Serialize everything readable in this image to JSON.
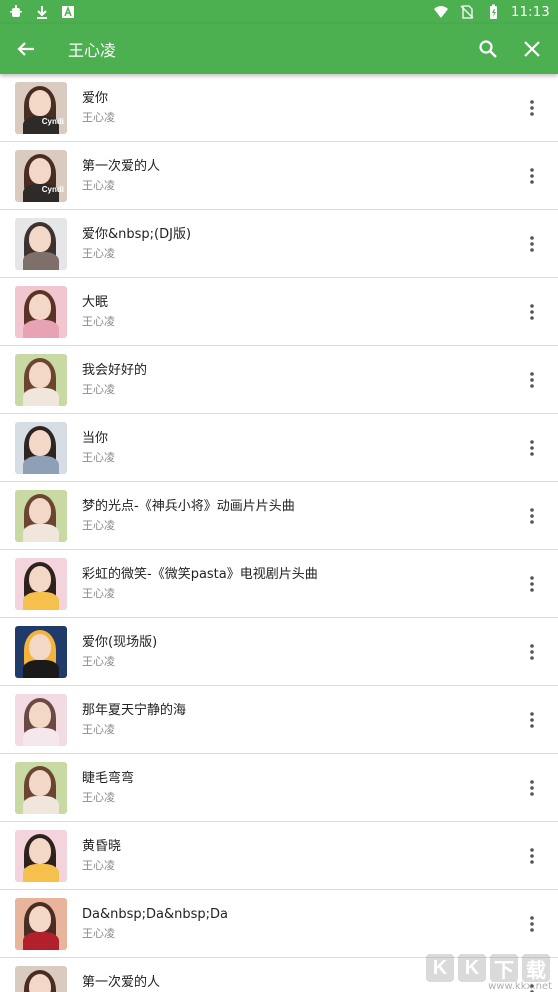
{
  "status_bar": {
    "time": "11:13",
    "left_icons": [
      "bug-icon",
      "download-icon",
      "a-icon"
    ],
    "right_icons": [
      "wifi-icon",
      "no-sim-icon",
      "battery-icon"
    ]
  },
  "app_bar": {
    "title": "王心凌",
    "back_icon": "arrow-back-icon",
    "search_icon": "search-icon",
    "close_icon": "close-icon",
    "color": "#4caf50"
  },
  "songs": [
    {
      "title": "爱你",
      "artist": "王心凌",
      "cover": {
        "bg": "#d9cbbf",
        "hair": "#4a2d22",
        "body": "#2d2a28",
        "tag": "Cyndi"
      }
    },
    {
      "title": "第一次爱的人",
      "artist": "王心凌",
      "cover": {
        "bg": "#d9cbbf",
        "hair": "#4a2d22",
        "body": "#2d2a28",
        "tag": "Cyndi"
      }
    },
    {
      "title": "爱你&nbsp;(DJ版)",
      "artist": "王心凌",
      "cover": {
        "bg": "#e6e6e8",
        "hair": "#3c3330",
        "body": "#7f6f6a",
        "tag": ""
      }
    },
    {
      "title": "大眠",
      "artist": "王心凌",
      "cover": {
        "bg": "#f2c6cf",
        "hair": "#5b3326",
        "body": "#e7a3b4",
        "tag": ""
      }
    },
    {
      "title": "我会好好的",
      "artist": "王心凌",
      "cover": {
        "bg": "#c8d9a3",
        "hair": "#6b4530",
        "body": "#f0e6dc",
        "tag": ""
      }
    },
    {
      "title": "当你",
      "artist": "王心凌",
      "cover": {
        "bg": "#d7dde5",
        "hair": "#2c2522",
        "body": "#8ea0b6",
        "tag": ""
      }
    },
    {
      "title": "梦的光点-《神兵小将》动画片片头曲",
      "artist": "王心凌",
      "cover": {
        "bg": "#c8d9a3",
        "hair": "#6b4530",
        "body": "#f0e6dc",
        "tag": ""
      }
    },
    {
      "title": "彩虹的微笑-《微笑pasta》电视剧片头曲",
      "artist": "王心凌",
      "cover": {
        "bg": "#f3d3dc",
        "hair": "#2f211c",
        "body": "#f6c04c",
        "tag": ""
      }
    },
    {
      "title": "爱你(现场版)",
      "artist": "王心凌",
      "cover": {
        "bg": "#203a6a",
        "hair": "#f4b43a",
        "body": "#1a1a1a",
        "tag": ""
      }
    },
    {
      "title": "那年夏天宁静的海",
      "artist": "王心凌",
      "cover": {
        "bg": "#f2dbe2",
        "hair": "#6b4a44",
        "body": "#f4e8ec",
        "tag": ""
      }
    },
    {
      "title": "睫毛弯弯",
      "artist": "王心凌",
      "cover": {
        "bg": "#c8d9a3",
        "hair": "#6b4530",
        "body": "#f0e6dc",
        "tag": ""
      }
    },
    {
      "title": "黄昏晓",
      "artist": "王心凌",
      "cover": {
        "bg": "#f3d3dc",
        "hair": "#2f211c",
        "body": "#f6c04c",
        "tag": ""
      }
    },
    {
      "title": "Da&nbsp;Da&nbsp;Da",
      "artist": "王心凌",
      "cover": {
        "bg": "#e8b59c",
        "hair": "#4a2d22",
        "body": "#b2202b",
        "tag": ""
      }
    },
    {
      "title": "第一次爱的人",
      "artist": "王心凌",
      "cover": {
        "bg": "#d9cbbf",
        "hair": "#4a2d22",
        "body": "#2d2a28",
        "tag": ""
      }
    }
  ],
  "more_icon": "more-vert-icon",
  "watermark": {
    "chars": [
      "K",
      "K",
      "下",
      "载"
    ],
    "url": "www.kkx.net"
  }
}
